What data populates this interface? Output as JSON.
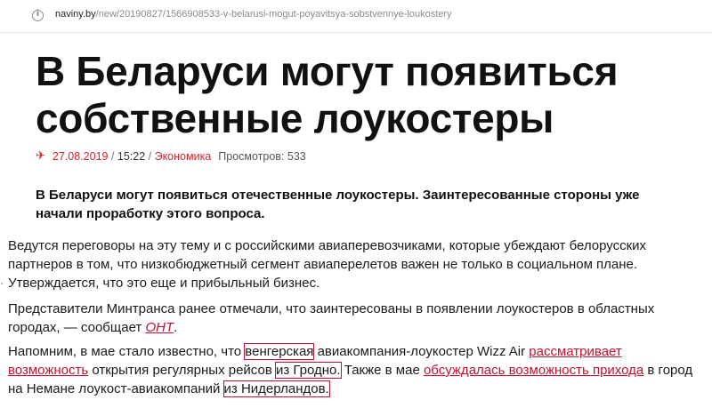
{
  "browser": {
    "url_host": "naviny.by",
    "url_path": "/new/20190827/1566908533-v-belarusi-mogut-poyavitsya-sobstvennye-loukostery"
  },
  "article": {
    "title": "В Беларуси могут появиться собственные лоукостеры",
    "meta": {
      "date": "27.08.2019",
      "separator1": " / ",
      "time": "15:22",
      "separator2": " / ",
      "category": "Экономика",
      "views_label": "Просмотров: 533"
    },
    "lead": "В Беларуси могут появиться отечественные лоукостеры. Заинтересованные стороны уже начали проработку этого вопроса.",
    "p1": "Ведутся переговоры на эту тему и с российскими авиаперевозчиками, которые убеждают белорусских партнеров в том, что низкобюджетный сегмент авиаперелетов важен не только в социальном плане. Утверждается, что это еще и прибыльный бизнес.",
    "p2": {
      "before": "Представители Минтранса ранее отмечали, что заинтересованы в появлении лоукостеров в областных городах, — сообщает ",
      "link": "ОНТ",
      "after": "."
    },
    "p3": {
      "t1": "Напомним, в мае стало известно, что ",
      "box1": "венгерская",
      "t2": " авиакомпания-лоукостер Wizz Air ",
      "link1": "рассматривает возможность",
      "t3": " открытия регулярных рейсов ",
      "box2": "из Гродно.",
      "t4": " Также в мае ",
      "link2": "обсуждалась возможность прихода",
      "t5": " в город на Немане лоукост-авиакомпаний ",
      "box3": "из Нидерландов."
    }
  },
  "colors": {
    "accent": "#d8232a",
    "link": "#c8102e"
  }
}
